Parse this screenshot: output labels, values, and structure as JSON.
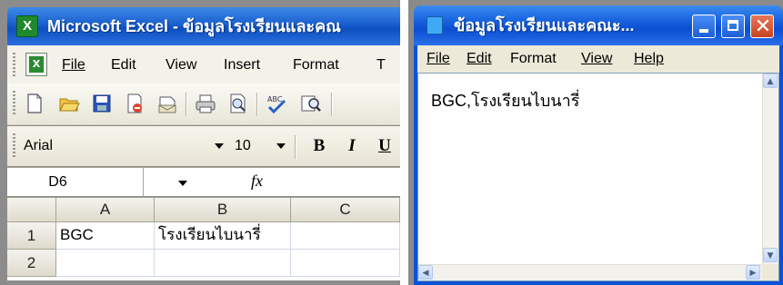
{
  "excel": {
    "title": "Microsoft Excel - ข้อมูลโรงเรียนและคณ",
    "app_icon_letter": "X",
    "menu": [
      "File",
      "Edit",
      "View",
      "Insert",
      "Format",
      "T"
    ],
    "font_name": "Arial",
    "font_size": "10",
    "format_buttons": {
      "bold": "B",
      "italic": "I",
      "underline": "U"
    },
    "name_box": "D6",
    "fx_label": "fx",
    "columns": [
      "A",
      "B",
      "C"
    ],
    "rows": [
      {
        "num": "1",
        "cells": [
          "BGC",
          "โรงเรียนไบนารี่",
          ""
        ]
      },
      {
        "num": "2",
        "cells": [
          "",
          "",
          ""
        ]
      }
    ]
  },
  "notepad": {
    "title": "ข้อมูลโรงเรียนและคณะ...",
    "menu": [
      "File",
      "Edit",
      "Format",
      "View",
      "Help"
    ],
    "content": "BGC,โรงเรียนไบนารี่",
    "close_glyph": "✕"
  }
}
